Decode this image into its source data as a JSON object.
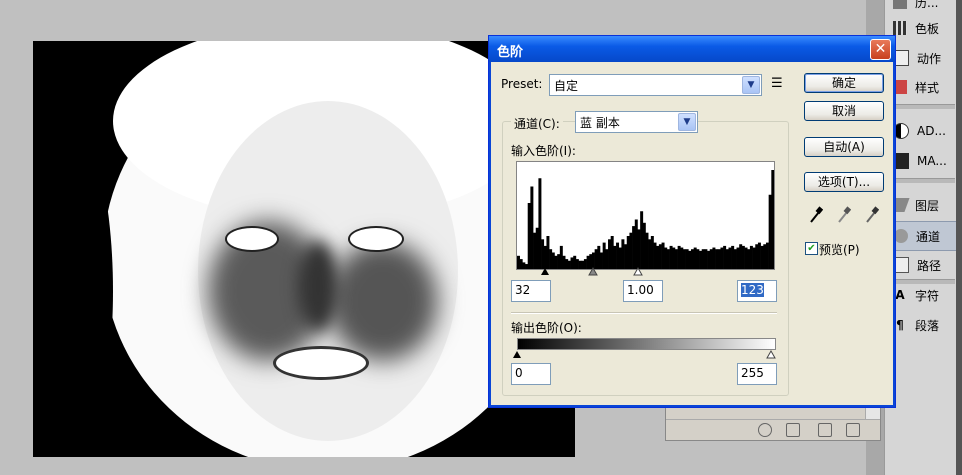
{
  "dialog": {
    "title": "色阶",
    "close_glyph": "✕",
    "preset_label": "Preset:",
    "preset_value": "自定",
    "channel_label": "通道(C):",
    "channel_value": "蓝 副本",
    "input_levels_label": "输入色阶(I):",
    "input_black": "32",
    "input_gamma": "1.00",
    "input_white": "123",
    "output_levels_label": "输出色阶(O):",
    "output_black": "0",
    "output_white": "255",
    "buttons": {
      "ok": "确定",
      "cancel": "取消",
      "auto": "自动(A)",
      "options": "选项(T)..."
    },
    "preview_label": "预览(P)",
    "preview_checked": true
  },
  "histogram": {
    "values": [
      8,
      6,
      4,
      3,
      40,
      50,
      22,
      25,
      55,
      18,
      14,
      20,
      12,
      10,
      8,
      9,
      14,
      8,
      6,
      5,
      7,
      8,
      6,
      5,
      5,
      6,
      8,
      9,
      10,
      12,
      14,
      10,
      16,
      12,
      18,
      20,
      14,
      16,
      13,
      18,
      15,
      20,
      22,
      26,
      30,
      24,
      35,
      28,
      22,
      18,
      20,
      16,
      14,
      15,
      16,
      13,
      12,
      14,
      13,
      12,
      14,
      13,
      12,
      12,
      11,
      12,
      13,
      12,
      11,
      12,
      12,
      11,
      12,
      13,
      12,
      12,
      13,
      14,
      12,
      13,
      14,
      12,
      13,
      15,
      14,
      13,
      12,
      14,
      13,
      15,
      16,
      14,
      15,
      16,
      45,
      60
    ]
  },
  "panel": {
    "items": [
      {
        "label": "色板",
        "icon": "swatches-icon"
      },
      {
        "label": "动作",
        "icon": "actions-icon"
      },
      {
        "label": "样式",
        "icon": "styles-icon"
      },
      {
        "label": "AD...",
        "icon": "adjustments-icon"
      },
      {
        "label": "MA...",
        "icon": "masks-icon"
      },
      {
        "label": "图层",
        "icon": "layers-icon"
      },
      {
        "label": "通道",
        "icon": "channels-icon"
      },
      {
        "label": "路径",
        "icon": "paths-icon"
      },
      {
        "label": "字符",
        "icon": "character-icon"
      },
      {
        "label": "段落",
        "icon": "paragraph-icon"
      }
    ],
    "top_partial": "历..."
  }
}
